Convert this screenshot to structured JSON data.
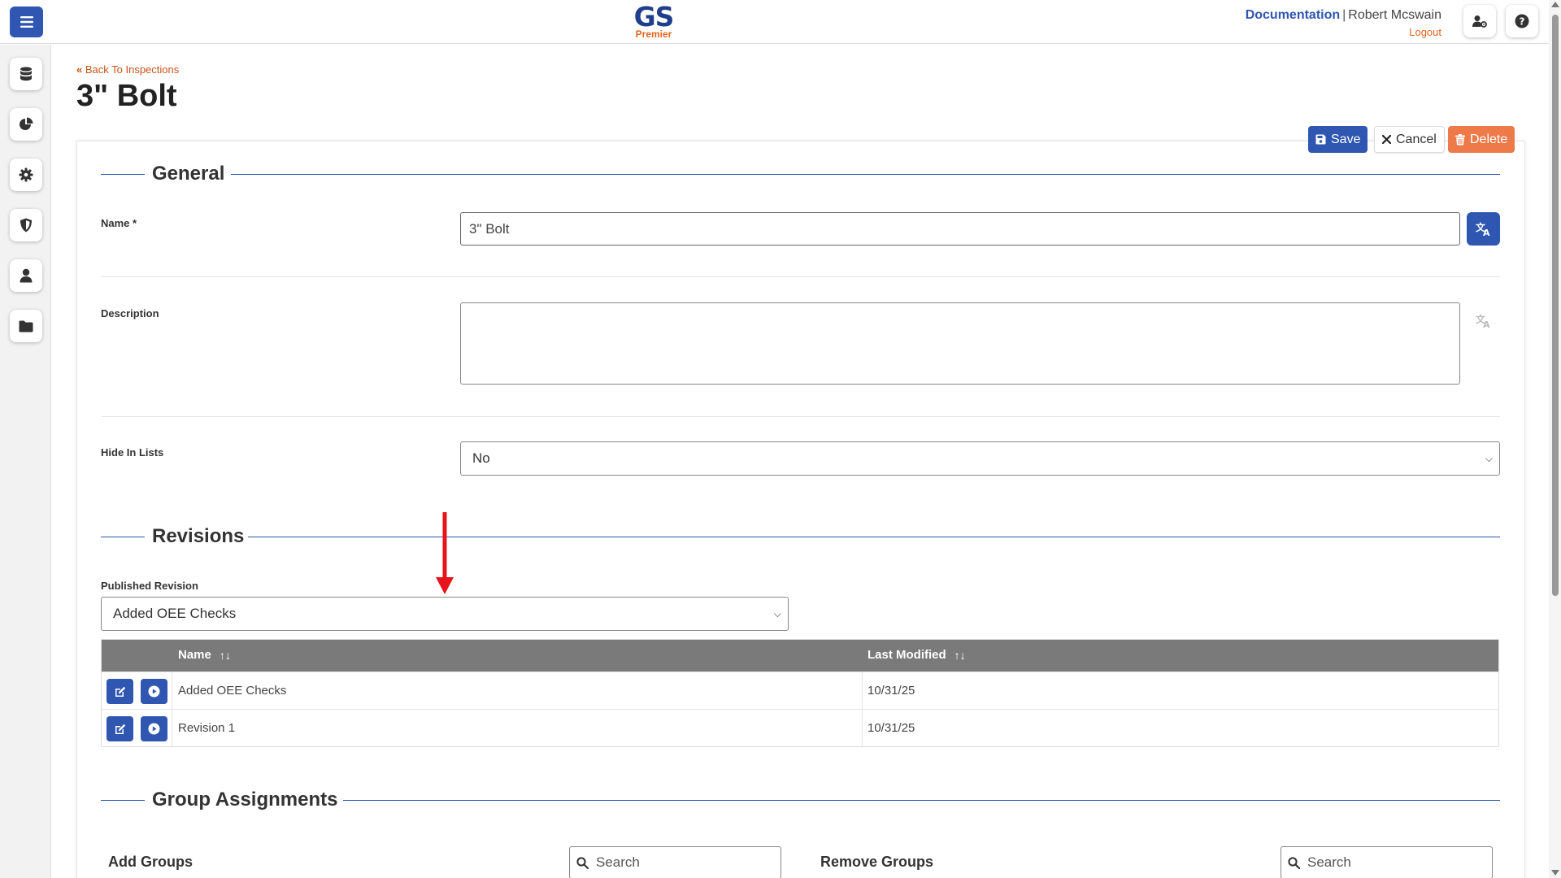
{
  "header": {
    "logo_text": "GS",
    "logo_sub": "Premier",
    "documentation": "Documentation",
    "separator": "|",
    "user_name": "Robert Mcswain",
    "logout": "Logout"
  },
  "sidebar": {
    "items": [
      {
        "icon": "database-icon"
      },
      {
        "icon": "pie-chart-icon"
      },
      {
        "icon": "gear-icon"
      },
      {
        "icon": "shield-icon"
      },
      {
        "icon": "user-icon"
      },
      {
        "icon": "folder-icon"
      }
    ]
  },
  "page": {
    "back_link": "Back To Inspections",
    "title": "3\" Bolt"
  },
  "actions": {
    "save": "Save",
    "cancel": "Cancel",
    "delete": "Delete"
  },
  "general": {
    "heading": "General",
    "name_label": "Name *",
    "name_value": "3\" Bolt",
    "description_label": "Description",
    "description_value": "",
    "hide_label": "Hide In Lists",
    "hide_value": "No"
  },
  "revisions": {
    "heading": "Revisions",
    "published_label": "Published Revision",
    "published_value": "Added OEE Checks",
    "columns": [
      "Name",
      "Last Modified"
    ],
    "sort_glyph": "↑↓",
    "rows": [
      {
        "name": "Added OEE Checks",
        "last_modified": "10/31/25"
      },
      {
        "name": "Revision 1",
        "last_modified": "10/31/25"
      }
    ]
  },
  "groups": {
    "heading": "Group Assignments",
    "add_label": "Add Groups",
    "remove_label": "Remove Groups",
    "search_placeholder": "Search"
  },
  "colors": {
    "primary": "#2f56b0",
    "accent": "#e2651d",
    "delete": "#ee7a4a",
    "table_header": "#7a7a7a",
    "annotation_arrow": "#e8141b"
  }
}
